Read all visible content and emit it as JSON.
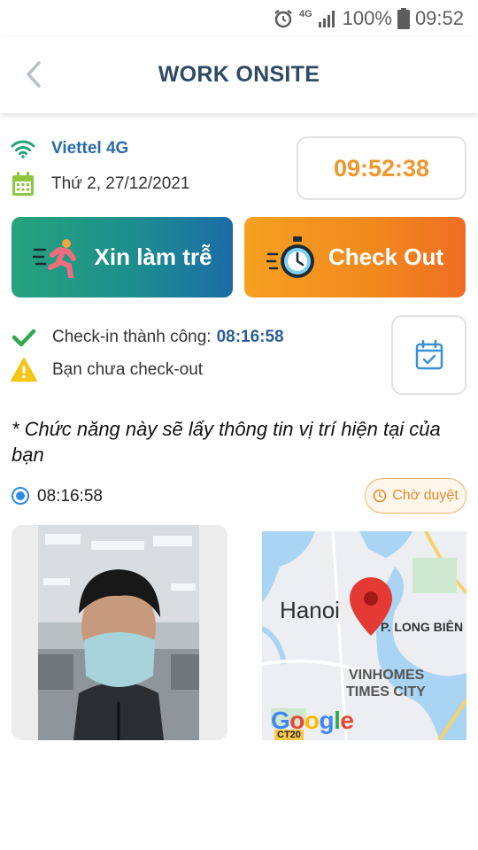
{
  "status_bar": {
    "network_type": "4G",
    "battery": "100%",
    "time": "09:52"
  },
  "header": {
    "title": "WORK ONSITE"
  },
  "info": {
    "network": "Viettel 4G",
    "date": "Thứ 2, 27/12/2021",
    "clock": "09:52:38"
  },
  "actions": {
    "late_label": "Xin làm trễ",
    "checkout_label": "Check Out"
  },
  "status": {
    "checkin_label": "Check-in thành công:",
    "checkin_time": "08:16:58",
    "checkout_warning": "Bạn chưa check-out"
  },
  "note": "* Chức năng này sẽ lấy thông tin vị trí hiện tại của bạn",
  "record": {
    "time": "08:16:58",
    "badge": "Chờ duyệt"
  },
  "map": {
    "city": "Hanoi",
    "district": "P. LONG BIÊN",
    "area_line1": "VINHOMES",
    "area_line2": "TIMES CITY",
    "road_badge": "CT20"
  },
  "colors": {
    "title": "#2f4a64",
    "network": "#2b6aa8",
    "clock": "#f0962a",
    "late_gradient_start": "#26a37c",
    "late_gradient_end": "#1b6ca6",
    "checkout_gradient_start": "#f7a021",
    "checkout_gradient_end": "#ef6e22",
    "success": "#2fa84f",
    "warning": "#f5c518",
    "pending": "#e8892a"
  }
}
